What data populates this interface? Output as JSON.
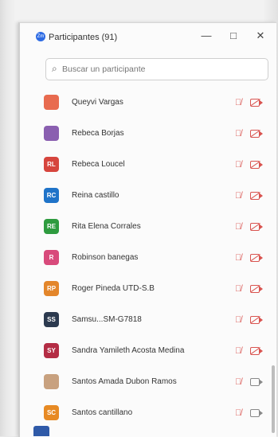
{
  "window": {
    "app_icon_text": "Zm",
    "title": "Participantes (91)",
    "minimize": "—",
    "maximize": "□",
    "close": "✕"
  },
  "search": {
    "placeholder": "Buscar un participante"
  },
  "participants": [
    {
      "initials": "",
      "name": "Queyvi Vargas",
      "color": "#e86b4f",
      "mic_muted": true,
      "cam_off": true
    },
    {
      "initials": "",
      "name": "Rebeca Borjas",
      "color": "#8a5fb0",
      "mic_muted": true,
      "cam_off": true
    },
    {
      "initials": "RL",
      "name": "Rebeca Loucel",
      "color": "#d6453d",
      "mic_muted": true,
      "cam_off": true
    },
    {
      "initials": "RC",
      "name": "Reina castillo",
      "color": "#1f73c8",
      "mic_muted": true,
      "cam_off": true
    },
    {
      "initials": "RE",
      "name": "Rita Elena Corrales",
      "color": "#2e9b3f",
      "mic_muted": true,
      "cam_off": true
    },
    {
      "initials": "R",
      "name": "Robinson banegas",
      "color": "#d84a7b",
      "mic_muted": true,
      "cam_off": true
    },
    {
      "initials": "RP",
      "name": "Roger Pineda UTD-S.B",
      "color": "#e3862b",
      "mic_muted": true,
      "cam_off": true
    },
    {
      "initials": "SS",
      "name": "Samsu...SM-G7818",
      "color": "#2c3a4f",
      "mic_muted": true,
      "cam_off": true
    },
    {
      "initials": "SY",
      "name": "Sandra Yamileth Acosta Medina",
      "color": "#b42d45",
      "mic_muted": true,
      "cam_off": true
    },
    {
      "initials": "",
      "name": "Santos Amada Dubon Ramos",
      "color": "#c8a17f",
      "mic_muted": true,
      "cam_off": false
    },
    {
      "initials": "SC",
      "name": "Santos cantillano",
      "color": "#e78a24",
      "mic_muted": true,
      "cam_off": false
    }
  ]
}
